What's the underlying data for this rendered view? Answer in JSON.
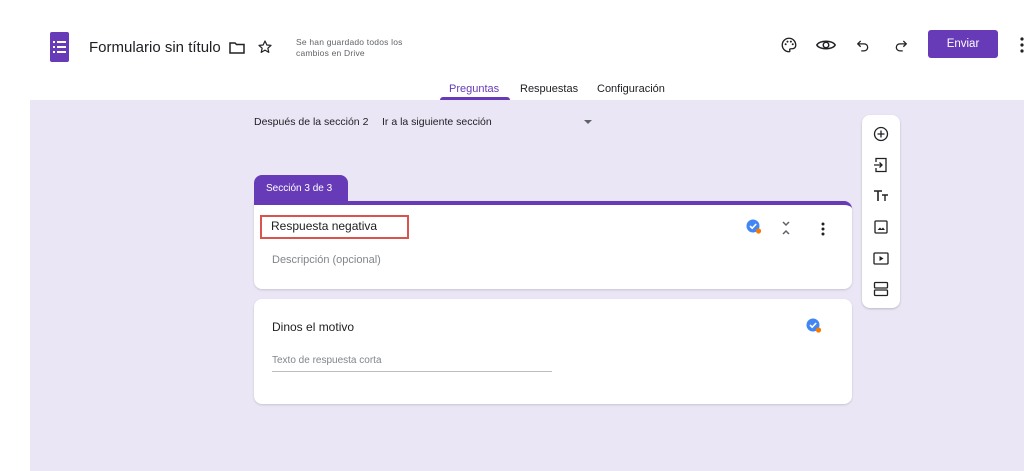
{
  "header": {
    "title": "Formulario sin título",
    "save_status": "Se han guardado todos los cambios en Drive",
    "send_label": "Enviar",
    "icons": [
      "forms-logo-icon",
      "folder-icon",
      "star-icon",
      "palette-icon",
      "preview-eye-icon",
      "undo-icon",
      "redo-icon",
      "more-vert-icon"
    ]
  },
  "tabs": [
    {
      "label": "Preguntas",
      "active": true
    },
    {
      "label": "Respuestas",
      "active": false
    },
    {
      "label": "Configuración",
      "active": false
    }
  ],
  "navigation": {
    "after_section_label": "Después de la sección 2",
    "after_section_value": "Ir a la siguiente sección"
  },
  "section": {
    "tab_label": "Sección 3 de 3",
    "title": "Respuesta negativa",
    "description_placeholder": "Descripción (opcional)"
  },
  "question": {
    "title": "Dinos el motivo",
    "answer_placeholder": "Texto de respuesta corta"
  },
  "toolbar": {
    "items": [
      "add-question-icon",
      "import-questions-icon",
      "add-title-icon",
      "add-image-icon",
      "add-video-icon",
      "add-section-icon"
    ]
  },
  "colors": {
    "accent": "#673ab7",
    "background": "#eae6f5",
    "highlight": "#d9534f",
    "badge_blue": "#4285f4",
    "badge_orange": "#f57c00"
  }
}
